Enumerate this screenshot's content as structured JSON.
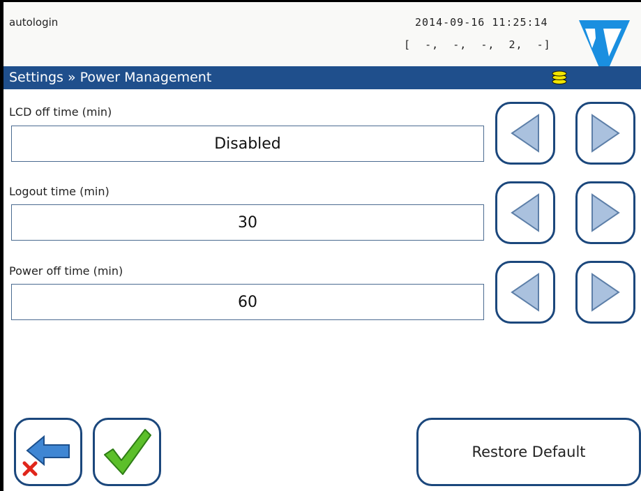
{
  "header": {
    "user": "autologin",
    "datetime": "2014-09-16  11:25:14",
    "status_line": "[  -,  -,  -,  2,  -]",
    "logo_icon": "brand-logo-icon"
  },
  "titlebar": {
    "title": "Settings » Power Management",
    "storage_icon": "database-icon"
  },
  "settings": [
    {
      "label": "LCD off time (min)",
      "value": "Disabled"
    },
    {
      "label": "Logout time (min)",
      "value": "30"
    },
    {
      "label": "Power off time (min)",
      "value": "60"
    }
  ],
  "footer": {
    "back_icon": "back-cancel-icon",
    "ok_icon": "checkmark-icon",
    "restore_label": "Restore Default"
  },
  "colors": {
    "accent": "#1f4f8c",
    "button_border": "#1b477c",
    "coin": "#f2e600",
    "check": "#5cbf2a",
    "cancel_x": "#e0261b"
  }
}
